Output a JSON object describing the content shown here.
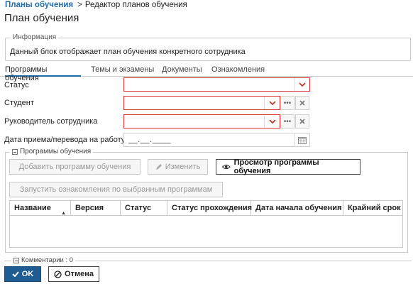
{
  "breadcrumb": {
    "parent": "Планы обучения",
    "separator": ">",
    "current": "Редактор планов обучения"
  },
  "page_title": "План обучения",
  "info": {
    "legend": "Информация",
    "text": "Данный блок отображает план обучения конкретного сотрудника"
  },
  "tabs": [
    {
      "label": "Программы обучения",
      "active": true
    },
    {
      "label": "Темы и экзамены",
      "active": false
    },
    {
      "label": "Документы",
      "active": false
    },
    {
      "label": "Ознакомления",
      "active": false
    }
  ],
  "fields": {
    "status": {
      "label": "Статус",
      "value": ""
    },
    "student": {
      "label": "Студент",
      "value": ""
    },
    "manager": {
      "label": "Руководитель сотрудника",
      "value": ""
    },
    "hire_date": {
      "label": "Дата приема/перевода на работу",
      "value": "__.__.____"
    }
  },
  "programs": {
    "legend": "Программы обучения",
    "add_button": "Добавить программу обучения",
    "edit_button": "Изменить",
    "view_button": "Просмотр программы обучения",
    "launch_button": "Запустить ознакомления по выбранным программам",
    "columns": [
      "Название",
      "Версия",
      "Статус",
      "Статус прохождения",
      "Дата начала обучения",
      "Крайний срок"
    ],
    "rows": []
  },
  "comments": {
    "label": "Комментарии : 0"
  },
  "footer": {
    "ok": "OK",
    "cancel": "Отмена"
  },
  "colors": {
    "accent": "#1f6ca8",
    "error_border": "#d9353b",
    "primary_button": "#1f5c91"
  }
}
